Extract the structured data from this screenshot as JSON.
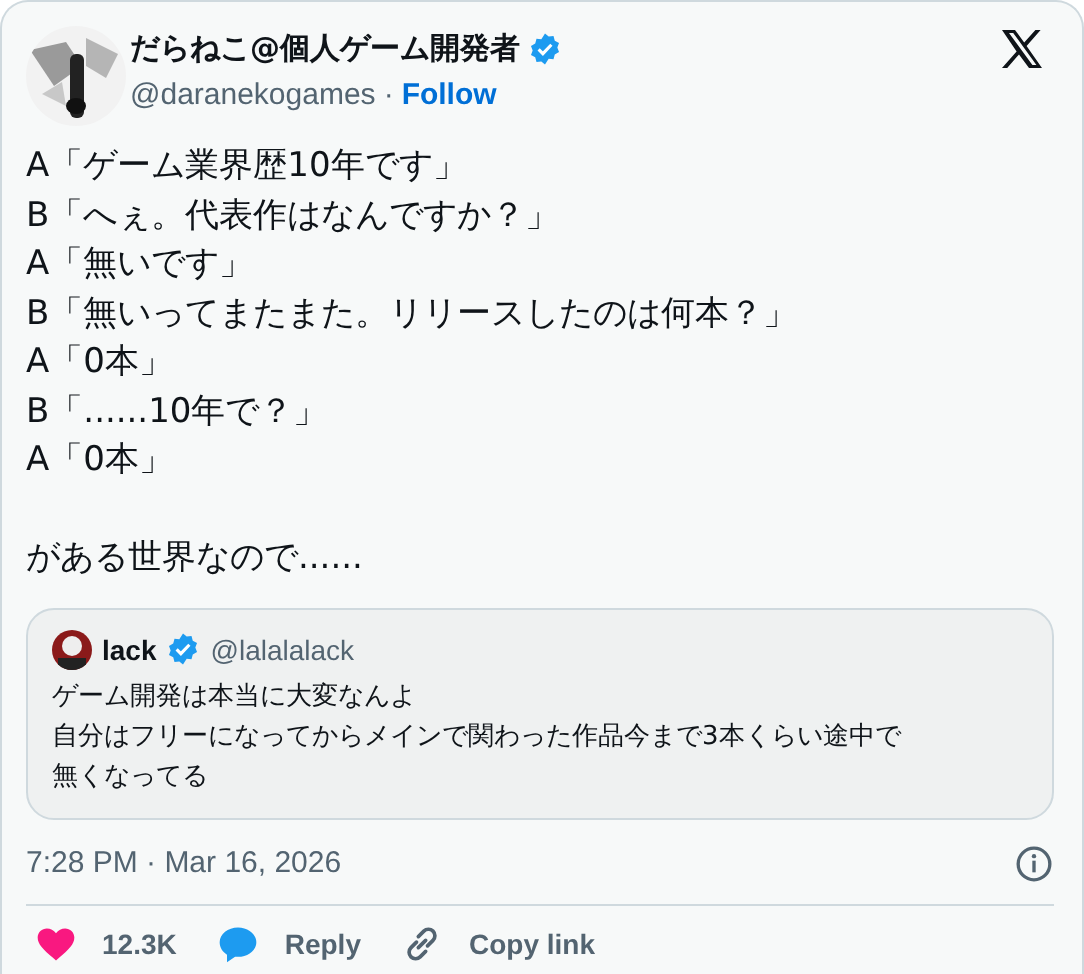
{
  "author": {
    "name": "だらねこ@個人ゲーム開発者",
    "verified": true,
    "handle": "@daranekogames",
    "separator": "·",
    "follow": "Follow"
  },
  "text_lines": [
    "A「ゲーム業界歴10年です」",
    "B「へぇ。代表作はなんですか？」",
    "A「無いです」",
    "B「無いってまたまた。リリースしたのは何本？」",
    "A「0本」",
    "B「......10年で？」",
    "A「0本」"
  ],
  "closing_line": "がある世界なので......",
  "quoted": {
    "name": "lack",
    "verified": true,
    "handle": "@lalalalack",
    "lines": [
      "ゲーム開発は本当に大変なんよ",
      "自分はフリーになってからメインで関わった作品今まで3本くらい途中で",
      "無くなってる"
    ]
  },
  "timestamp": "7:28 PM · Mar 16, 2026",
  "actions": [
    {
      "kind": "like",
      "label": "12.3K"
    },
    {
      "kind": "reply",
      "label": "Reply"
    },
    {
      "kind": "copy",
      "label": "Copy link"
    }
  ]
}
